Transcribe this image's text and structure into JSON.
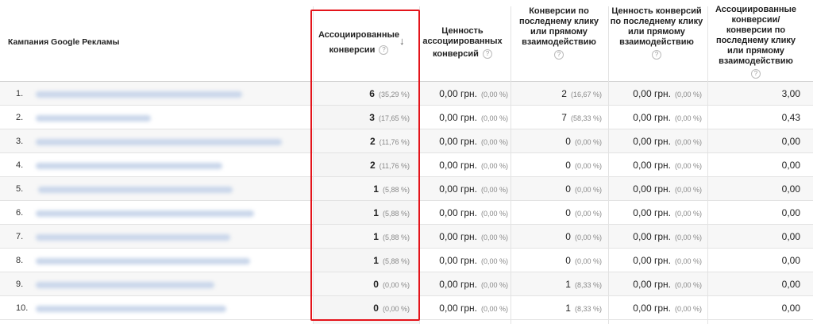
{
  "header": {
    "campaign": "Кампания Google Рекламы",
    "assisted_line1": "Ассоциированные",
    "assisted_line2": "конверсии",
    "assisted_value_line1": "Ценность",
    "assisted_value_line2": "ассоциированных",
    "assisted_value_line3": "конверсий",
    "last_click_line1": "Конверсии по",
    "last_click_line2": "последнему клику",
    "last_click_line3": "или прямому",
    "last_click_line4": "взаимодействию",
    "last_click_value_line1": "Ценность конверсий",
    "last_click_value_line2": "по последнему клику",
    "last_click_value_line3": "или прямому",
    "last_click_value_line4": "взаимодействию",
    "ratio_line1": "Ассоциированные",
    "ratio_line2": "конверсии/",
    "ratio_line3": "конверсии по",
    "ratio_line4": "последнему клику",
    "ratio_line5": "или прямому",
    "ratio_line6": "взаимодействию",
    "help_glyph": "?",
    "sort_glyph": "↓"
  },
  "rows": [
    {
      "num": "1.",
      "assisted": "6",
      "assisted_pct": "(35,29 %)",
      "av": "0,00 грн.",
      "av_pct": "(0,00 %)",
      "lc": "2",
      "lc_pct": "(16,67 %)",
      "lcv": "0,00 грн.",
      "lcv_pct": "(0,00 %)",
      "ratio": "3,00"
    },
    {
      "num": "2.",
      "assisted": "3",
      "assisted_pct": "(17,65 %)",
      "av": "0,00 грн.",
      "av_pct": "(0,00 %)",
      "lc": "7",
      "lc_pct": "(58,33 %)",
      "lcv": "0,00 грн.",
      "lcv_pct": "(0,00 %)",
      "ratio": "0,43"
    },
    {
      "num": "3.",
      "assisted": "2",
      "assisted_pct": "(11,76 %)",
      "av": "0,00 грн.",
      "av_pct": "(0,00 %)",
      "lc": "0",
      "lc_pct": "(0,00 %)",
      "lcv": "0,00 грн.",
      "lcv_pct": "(0,00 %)",
      "ratio": "0,00"
    },
    {
      "num": "4.",
      "assisted": "2",
      "assisted_pct": "(11,76 %)",
      "av": "0,00 грн.",
      "av_pct": "(0,00 %)",
      "lc": "0",
      "lc_pct": "(0,00 %)",
      "lcv": "0,00 грн.",
      "lcv_pct": "(0,00 %)",
      "ratio": "0,00"
    },
    {
      "num": "5.",
      "assisted": "1",
      "assisted_pct": "(5,88 %)",
      "av": "0,00 грн.",
      "av_pct": "(0,00 %)",
      "lc": "0",
      "lc_pct": "(0,00 %)",
      "lcv": "0,00 грн.",
      "lcv_pct": "(0,00 %)",
      "ratio": "0,00"
    },
    {
      "num": "6.",
      "assisted": "1",
      "assisted_pct": "(5,88 %)",
      "av": "0,00 грн.",
      "av_pct": "(0,00 %)",
      "lc": "0",
      "lc_pct": "(0,00 %)",
      "lcv": "0,00 грн.",
      "lcv_pct": "(0,00 %)",
      "ratio": "0,00"
    },
    {
      "num": "7.",
      "assisted": "1",
      "assisted_pct": "(5,88 %)",
      "av": "0,00 грн.",
      "av_pct": "(0,00 %)",
      "lc": "0",
      "lc_pct": "(0,00 %)",
      "lcv": "0,00 грн.",
      "lcv_pct": "(0,00 %)",
      "ratio": "0,00"
    },
    {
      "num": "8.",
      "assisted": "1",
      "assisted_pct": "(5,88 %)",
      "av": "0,00 грн.",
      "av_pct": "(0,00 %)",
      "lc": "0",
      "lc_pct": "(0,00 %)",
      "lcv": "0,00 грн.",
      "lcv_pct": "(0,00 %)",
      "ratio": "0,00"
    },
    {
      "num": "9.",
      "assisted": "0",
      "assisted_pct": "(0,00 %)",
      "av": "0,00 грн.",
      "av_pct": "(0,00 %)",
      "lc": "1",
      "lc_pct": "(8,33 %)",
      "lcv": "0,00 грн.",
      "lcv_pct": "(0,00 %)",
      "ratio": "0,00"
    },
    {
      "num": "10.",
      "assisted": "0",
      "assisted_pct": "(0,00 %)",
      "av": "0,00 грн.",
      "av_pct": "(0,00 %)",
      "lc": "1",
      "lc_pct": "(8,33 %)",
      "lcv": "0,00 грн.",
      "lcv_pct": "(0,00 %)",
      "ratio": "0,00"
    }
  ],
  "colors": {
    "highlight_border": "#e4141b",
    "blurred_link": "#c9d6ea",
    "percent_text": "#888888"
  },
  "icons": {
    "help": "help-icon",
    "sort": "sort-descending-icon"
  }
}
